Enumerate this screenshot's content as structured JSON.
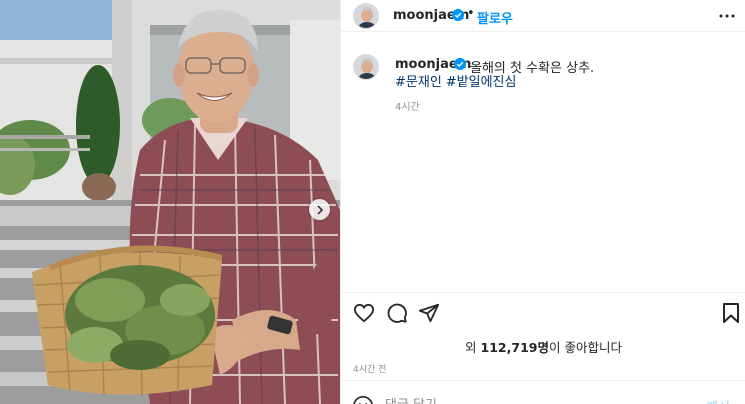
{
  "post": {
    "username": "moonjaein",
    "separator": "•",
    "follow_label": "팔로우",
    "more_icon": "more-horizontal-icon",
    "verified_icon": "verified-badge-icon"
  },
  "caption": {
    "username": "moonjaein",
    "text": "올해의 첫 수확은 상추.",
    "hashtags": [
      "#문재인",
      "#밭일에진심"
    ],
    "time": "4시간"
  },
  "actions": {
    "like_icon": "heart-icon",
    "comment_icon": "comment-icon",
    "share_icon": "paper-plane-icon",
    "save_icon": "bookmark-icon"
  },
  "likes": {
    "prefix": "외 ",
    "count": "112,719명",
    "suffix": "이 좋아합니다"
  },
  "post_time": "4시간 전",
  "comment": {
    "placeholder": "댓글 달기...",
    "post_label": "게시",
    "emoji_icon": "smiley-icon"
  },
  "colors": {
    "accent": "#0095f6",
    "hashtag": "#00376b",
    "muted": "#8e8e8e"
  }
}
